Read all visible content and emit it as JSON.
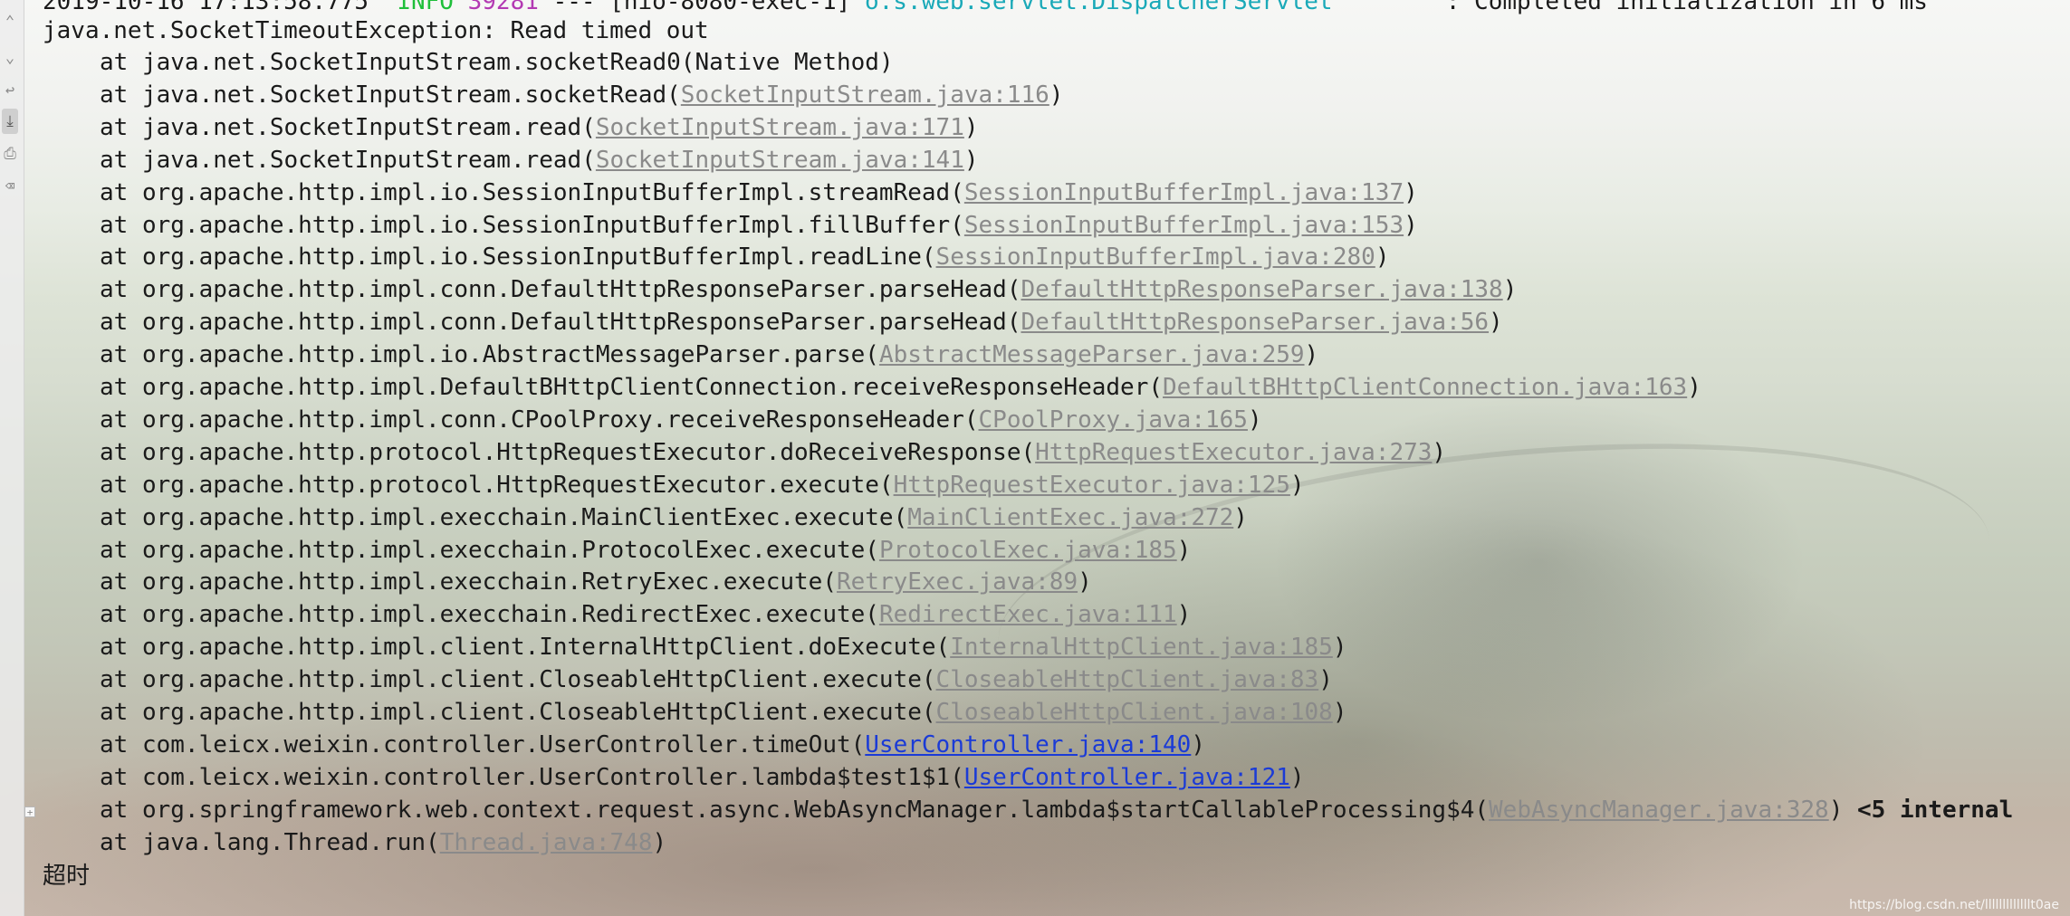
{
  "header_line": {
    "timestamp": "2019-10-16 17:13:58.775",
    "level": "INFO",
    "pid": "39281",
    "separator": "---",
    "thread": "[nio-8080-exec-1]",
    "logger": "o.s.web.servlet.DispatcherServlet",
    "message": ": Completed initialization in 6 ms"
  },
  "exception": "java.net.SocketTimeoutException: Read timed out",
  "frames": [
    {
      "text": "at java.net.SocketInputStream.socketRead0(",
      "link": "",
      "suffix": "Native Method)"
    },
    {
      "text": "at java.net.SocketInputStream.socketRead(",
      "link": "SocketInputStream.java:116",
      "suffix": ")"
    },
    {
      "text": "at java.net.SocketInputStream.read(",
      "link": "SocketInputStream.java:171",
      "suffix": ")"
    },
    {
      "text": "at java.net.SocketInputStream.read(",
      "link": "SocketInputStream.java:141",
      "suffix": ")"
    },
    {
      "text": "at org.apache.http.impl.io.SessionInputBufferImpl.streamRead(",
      "link": "SessionInputBufferImpl.java:137",
      "suffix": ")"
    },
    {
      "text": "at org.apache.http.impl.io.SessionInputBufferImpl.fillBuffer(",
      "link": "SessionInputBufferImpl.java:153",
      "suffix": ")"
    },
    {
      "text": "at org.apache.http.impl.io.SessionInputBufferImpl.readLine(",
      "link": "SessionInputBufferImpl.java:280",
      "suffix": ")"
    },
    {
      "text": "at org.apache.http.impl.conn.DefaultHttpResponseParser.parseHead(",
      "link": "DefaultHttpResponseParser.java:138",
      "suffix": ")"
    },
    {
      "text": "at org.apache.http.impl.conn.DefaultHttpResponseParser.parseHead(",
      "link": "DefaultHttpResponseParser.java:56",
      "suffix": ")"
    },
    {
      "text": "at org.apache.http.impl.io.AbstractMessageParser.parse(",
      "link": "AbstractMessageParser.java:259",
      "suffix": ")"
    },
    {
      "text": "at org.apache.http.impl.DefaultBHttpClientConnection.receiveResponseHeader(",
      "link": "DefaultBHttpClientConnection.java:163",
      "suffix": ")"
    },
    {
      "text": "at org.apache.http.impl.conn.CPoolProxy.receiveResponseHeader(",
      "link": "CPoolProxy.java:165",
      "suffix": ")"
    },
    {
      "text": "at org.apache.http.protocol.HttpRequestExecutor.doReceiveResponse(",
      "link": "HttpRequestExecutor.java:273",
      "suffix": ")"
    },
    {
      "text": "at org.apache.http.protocol.HttpRequestExecutor.execute(",
      "link": "HttpRequestExecutor.java:125",
      "suffix": ")"
    },
    {
      "text": "at org.apache.http.impl.execchain.MainClientExec.execute(",
      "link": "MainClientExec.java:272",
      "suffix": ")"
    },
    {
      "text": "at org.apache.http.impl.execchain.ProtocolExec.execute(",
      "link": "ProtocolExec.java:185",
      "suffix": ")"
    },
    {
      "text": "at org.apache.http.impl.execchain.RetryExec.execute(",
      "link": "RetryExec.java:89",
      "suffix": ")"
    },
    {
      "text": "at org.apache.http.impl.execchain.RedirectExec.execute(",
      "link": "RedirectExec.java:111",
      "suffix": ")"
    },
    {
      "text": "at org.apache.http.impl.client.InternalHttpClient.doExecute(",
      "link": "InternalHttpClient.java:185",
      "suffix": ")"
    },
    {
      "text": "at org.apache.http.impl.client.CloseableHttpClient.execute(",
      "link": "CloseableHttpClient.java:83",
      "suffix": ")"
    },
    {
      "text": "at org.apache.http.impl.client.CloseableHttpClient.execute(",
      "link": "CloseableHttpClient.java:108",
      "suffix": ")"
    },
    {
      "text": "at com.leicx.weixin.controller.UserController.timeOut(",
      "link": "UserController.java:140",
      "suffix": ")",
      "user": true
    },
    {
      "text": "at com.leicx.weixin.controller.UserController.lambda$test1$1(",
      "link": "UserController.java:121",
      "suffix": ")",
      "user": true
    },
    {
      "text": "at org.springframework.web.context.request.async.WebAsyncManager.lambda$startCallableProcessing$4(",
      "link": "WebAsyncManager.java:328",
      "suffix": ")",
      "internal": "<5 internal"
    },
    {
      "text": "at java.lang.Thread.run(",
      "link": "Thread.java:748",
      "suffix": ")"
    }
  ],
  "output_text": "超时",
  "watermark": "https://blog.csdn.net/lllllllllllllt0ae"
}
